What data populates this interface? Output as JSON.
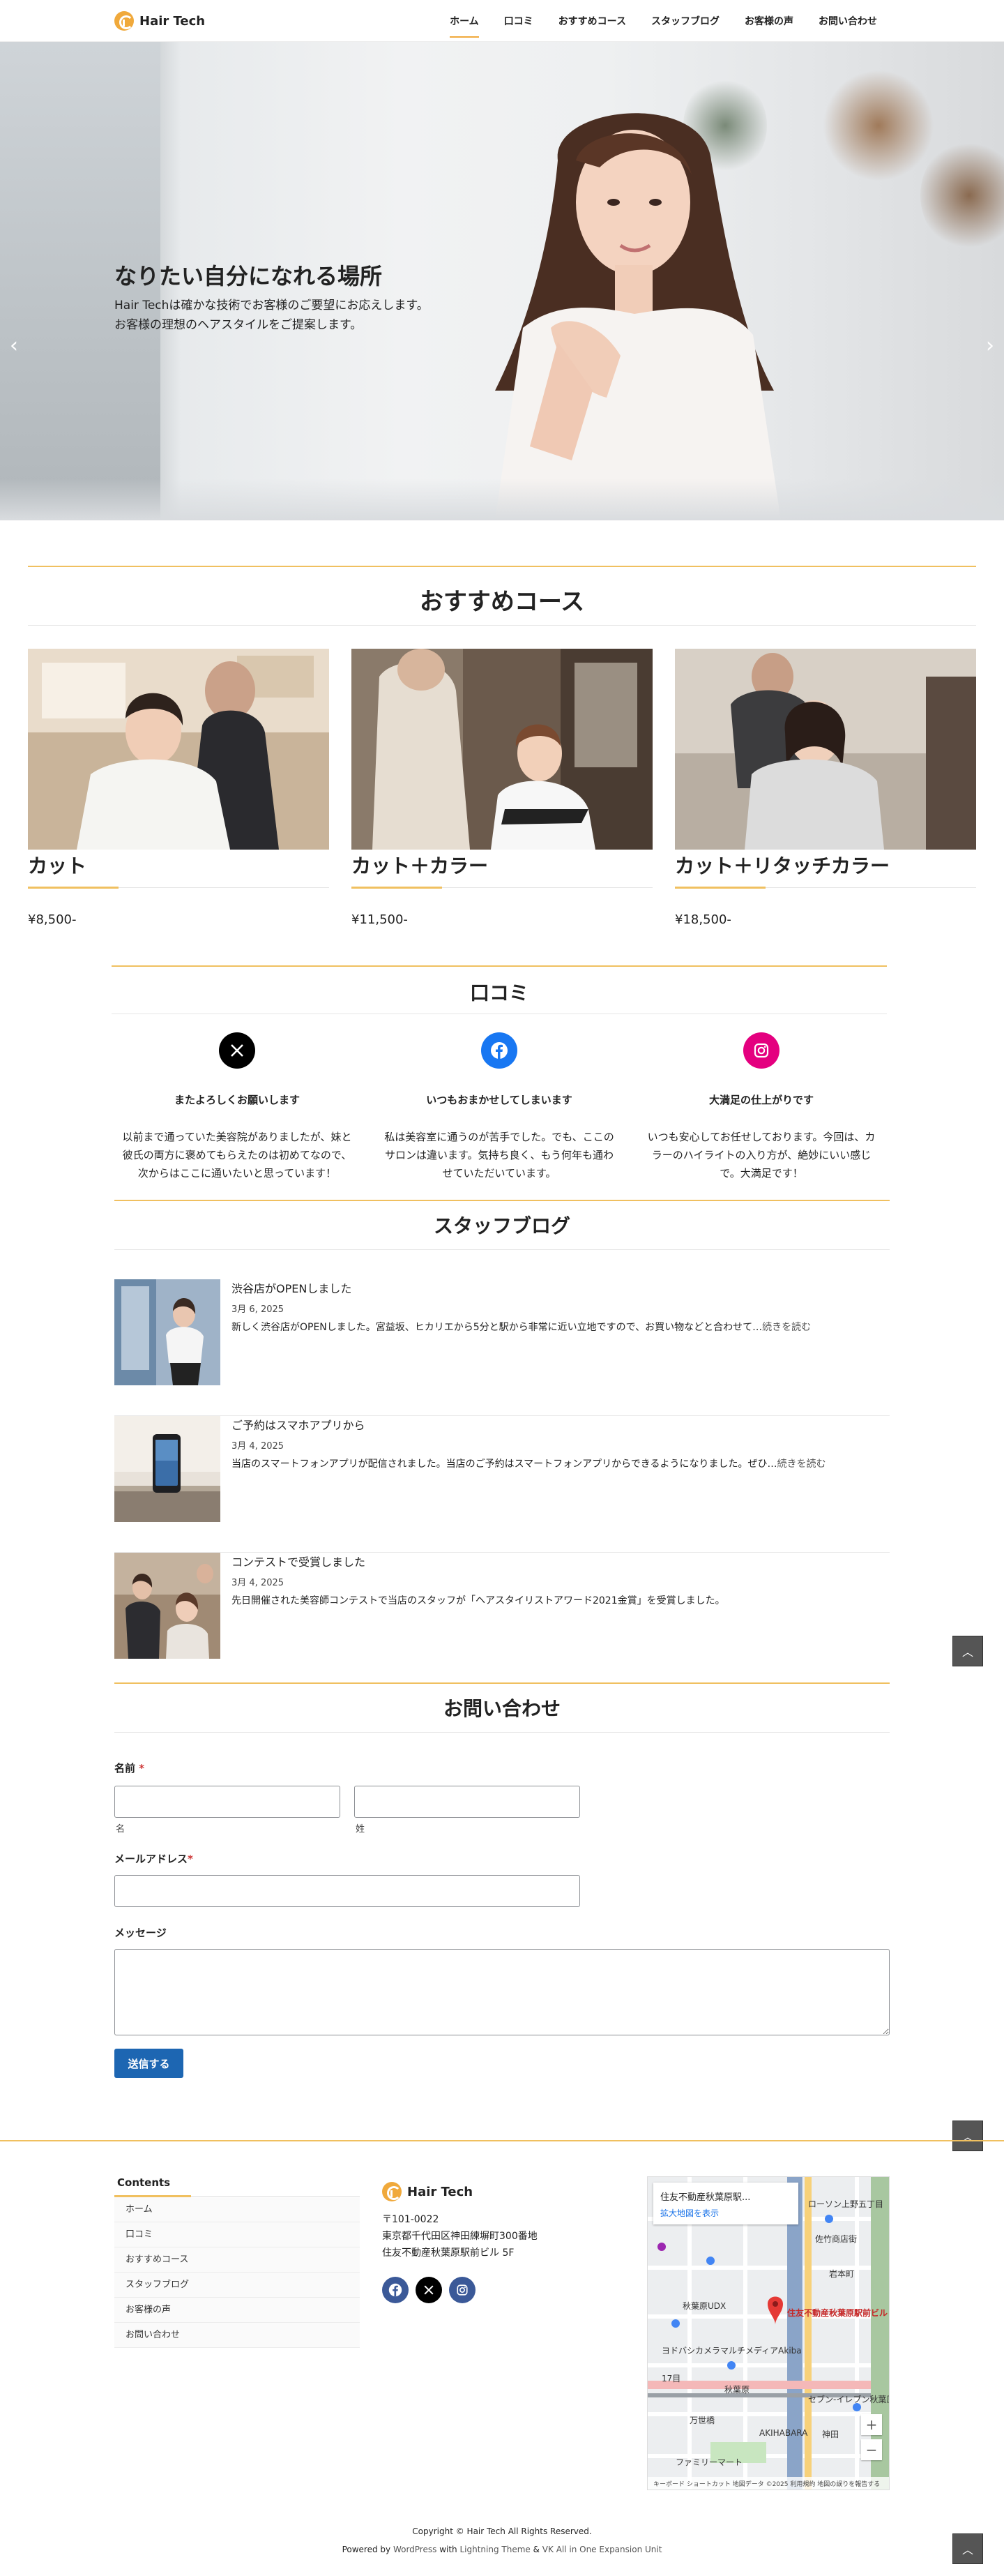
{
  "brand": {
    "name": "Hair Tech",
    "accent": "#f0a93b"
  },
  "nav": [
    "ホーム",
    "口コミ",
    "おすすめコース",
    "スタッフブログ",
    "お客様の声",
    "お問い合わせ"
  ],
  "hero": {
    "title": "なりたい自分になれる場所",
    "lines": [
      "Hair Techは確かな技術でお客様のご要望にお応えします。",
      "お客様の理想のヘアスタイルをご提案します。"
    ],
    "prev_icon": "‹",
    "next_icon": "›"
  },
  "courses": {
    "heading": "おすすめコース",
    "items": [
      {
        "name": "カット",
        "price": "¥8,500-"
      },
      {
        "name": "カット＋カラー",
        "price": "¥11,500-"
      },
      {
        "name": "カット＋リタッチカラー",
        "price": "¥18,500-"
      }
    ]
  },
  "reviews": {
    "heading": "口コミ",
    "items": [
      {
        "icon": "x-icon",
        "color": "#000000",
        "title": "またよろしくお願いします",
        "text": [
          "以前まで通っていた美容院がありましたが、妹と",
          "彼氏の両方に褒めてもらえたのは初めてなので、",
          "次からはここに通いたいと思っています！"
        ]
      },
      {
        "icon": "facebook-icon",
        "color": "#1877f2",
        "title": "いつもおまかせしてしまいます",
        "text": [
          "私は美容室に通うのが苦手でした。でも、ここの",
          "サロンは違います。気持ち良く、もう何年も通わ",
          "せていただいています。"
        ]
      },
      {
        "icon": "instagram-icon",
        "color": "#e4007f",
        "title": "大満足の仕上がりです",
        "text": [
          "いつも安心してお任せしております。今回は、カ",
          "ラーのハイライトの入り方が、絶妙にいい感じ",
          "で。大満足です！"
        ]
      }
    ]
  },
  "blog": {
    "heading": "スタッフブログ",
    "read_more": "続きを読む",
    "posts": [
      {
        "title": "渋谷店がOPENしました",
        "date": "3月 6, 2025",
        "excerpt": "新しく渋谷店がOPENしました。宮益坂、ヒカリエから5分と駅から非常に近い立地ですので、お買い物などと合わせて…"
      },
      {
        "title": "ご予約はスマホアプリから",
        "date": "3月 4, 2025",
        "excerpt": "当店のスマートフォンアプリが配信されました。当店のご予約はスマートフォンアプリからできるようになりました。ぜひ…"
      },
      {
        "title": "コンテストで受賞しました",
        "date": "3月 4, 2025",
        "excerpt": "先日開催された美容師コンテストで当店のスタッフが「ヘアスタイリストアワード2021金賞」を受賞しました。"
      }
    ]
  },
  "contact": {
    "heading": "お問い合わせ",
    "name_label": "名前",
    "required_mark": "*",
    "first_name_sub": "名",
    "last_name_sub": "姓",
    "email_label": "メールアドレス",
    "message_label": "メッセージ",
    "submit": "送信する"
  },
  "scroll_top_icon": "︿",
  "footer": {
    "contents_title": "Contents",
    "menu": [
      "ホーム",
      "口コミ",
      "おすすめコース",
      "スタッフブログ",
      "お客様の声",
      "お問い合わせ"
    ],
    "address": [
      "〒101-0022",
      "東京都千代田区神田練塀町300番地",
      "住友不動産秋葉原駅前ビル 5F"
    ],
    "social": [
      {
        "icon": "facebook-icon",
        "color": "#3b5998"
      },
      {
        "icon": "x-icon",
        "color": "#000000"
      },
      {
        "icon": "instagram-icon",
        "color": "#3b5998"
      }
    ],
    "map": {
      "card_title": "住友不動産秋葉原駅...",
      "card_link": "拡大地図を表示",
      "pin_label": "住友不動産秋葉原駅前ビル",
      "labels": [
        "ローソン上野五丁目",
        "佐竹商店街",
        "秋葉原UDX",
        "ヨドバシカメラマルチメディアAkiba",
        "秋葉原",
        "セブン-イレブン秋葉原昭和通り口",
        "神田",
        "ファミリーマート",
        "AKIHABARA",
        "万世橋",
        "岩本町",
        "17目"
      ],
      "zoom_in": "+",
      "zoom_out": "−",
      "attribution": "キーボード ショートカット   地図データ ©2025   利用規約   地図の誤りを報告する"
    },
    "copyright": "Copyright © Hair Tech All Rights Reserved.",
    "powered_prefix": "Powered by ",
    "powered_wp": "WordPress",
    "powered_mid": " with ",
    "powered_theme": "Lightning Theme",
    "powered_amp": " & ",
    "powered_unit": "VK All in One Expansion Unit"
  }
}
